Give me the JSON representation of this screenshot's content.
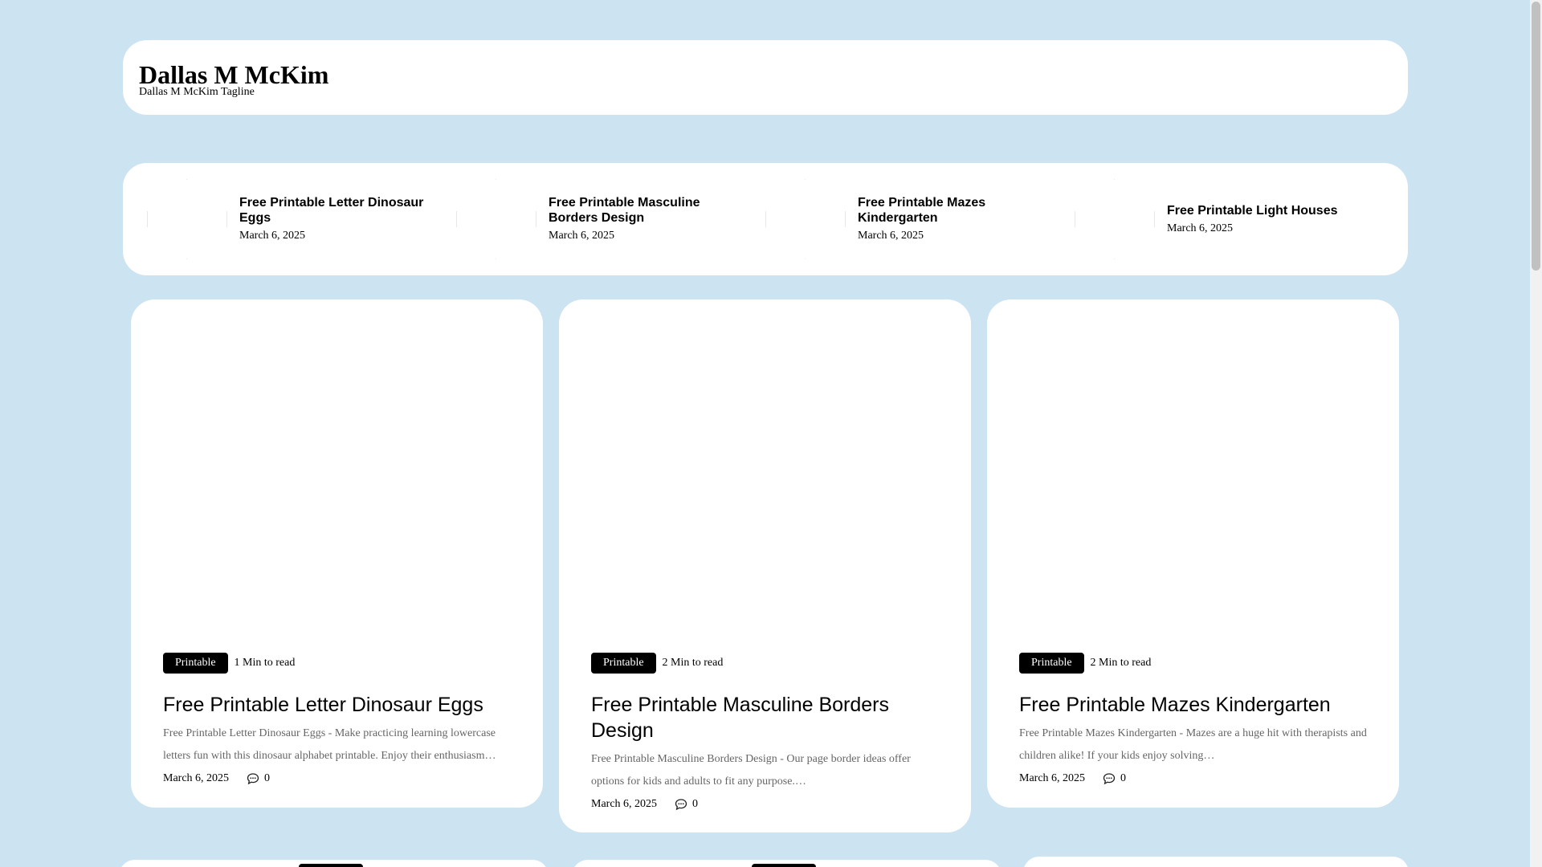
{
  "site": {
    "title": "Dallas M McKim",
    "tagline": "Dallas M McKim Tagline"
  },
  "ticker": [
    {
      "title": "Free Printable Letter Dinosaur Eggs",
      "date": "March 6, 2025"
    },
    {
      "title": "Free Printable Masculine Borders Design",
      "date": "March 6, 2025"
    },
    {
      "title": "Free Printable Mazes Kindergarten",
      "date": "March 6, 2025"
    },
    {
      "title": "Free Printable Light Houses",
      "date": "March 6, 2025"
    }
  ],
  "cards": [
    {
      "category": "Printable",
      "read_time": "1 Min to read",
      "title": "Free Printable Letter Dinosaur Eggs",
      "excerpt": "Free Printable Letter Dinosaur Eggs - Make practicing learning lowercase letters fun with this dinosaur alphabet printable. Enjoy their enthusiasm…",
      "date": "March 6, 2025",
      "comments": "0"
    },
    {
      "category": "Printable",
      "read_time": "2 Min to read",
      "title": "Free Printable Masculine Borders Design",
      "excerpt": "Free Printable Masculine Borders Design - Our page border ideas offer options for kids and adults to fit any purpose.…",
      "date": "March 6, 2025",
      "comments": "0"
    },
    {
      "category": "Printable",
      "read_time": "2 Min to read",
      "title": "Free Printable Mazes Kindergarten",
      "excerpt": "Free Printable Mazes Kindergarten - Mazes are a huge hit with therapists and children alike! If your kids enjoy solving…",
      "date": "March 6, 2025",
      "comments": "0"
    }
  ],
  "icons": {
    "comment": "comment-bubble-icon"
  }
}
